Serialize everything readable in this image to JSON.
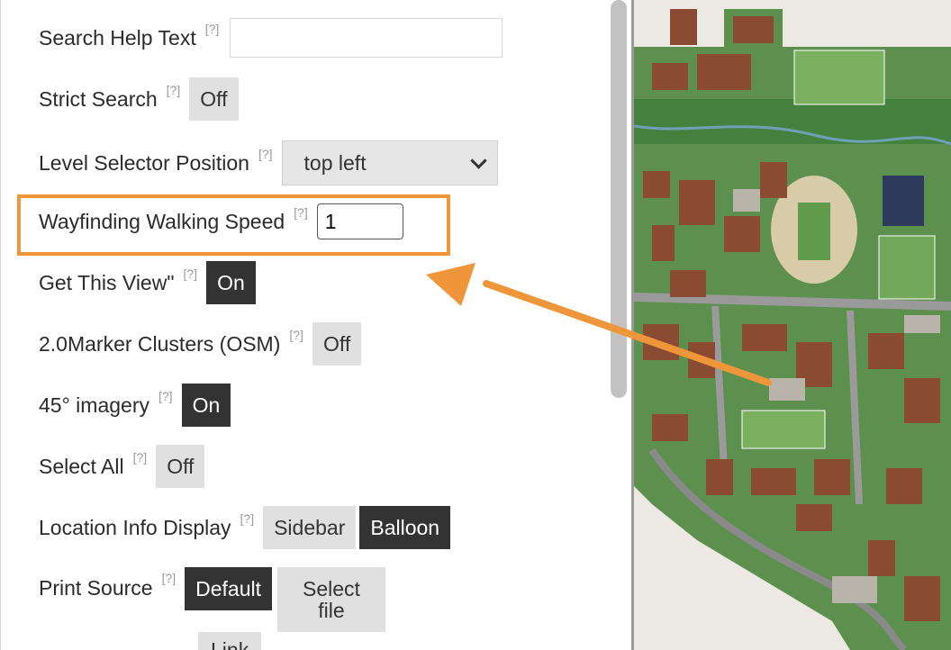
{
  "settings": {
    "help_marker": "[?]",
    "search_help_text": {
      "label": "Search Help Text",
      "value": ""
    },
    "strict_search": {
      "label": "Strict Search",
      "state": "Off"
    },
    "level_selector_position": {
      "label": "Level Selector Position",
      "selected": "top left"
    },
    "wayfinding_walking_speed": {
      "label": "Wayfinding Walking Speed",
      "value": "1"
    },
    "get_this_view": {
      "label": "Get This View\"",
      "state": "On"
    },
    "marker_clusters": {
      "label": "2.0Marker Clusters (OSM)",
      "state": "Off"
    },
    "imagery_45": {
      "label": "45° imagery",
      "state": "On"
    },
    "select_all": {
      "label": "Select All",
      "state": "Off"
    },
    "location_info_display": {
      "label": "Location Info Display",
      "options": [
        "Sidebar",
        "Balloon"
      ],
      "selected": "Balloon"
    },
    "print_source": {
      "label": "Print Source",
      "options": [
        "Default",
        "Select\nfile",
        "Link"
      ],
      "selected": "Default"
    }
  },
  "colors": {
    "highlight": "#f0963a",
    "button_on": "#333333",
    "button_off": "#e0e0e0",
    "map_background": "#ece9e3",
    "map_campus": "#3f7f3a"
  }
}
